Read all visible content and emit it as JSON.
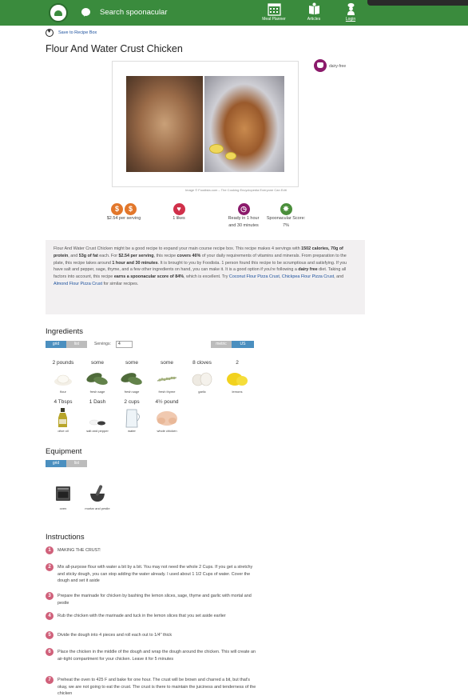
{
  "header": {
    "search_label": "Search spoonacular",
    "nav": [
      {
        "label": "Meal Planner",
        "icon": "calendar-icon"
      },
      {
        "label": "Articles",
        "icon": "book-icon"
      },
      {
        "label": "Login",
        "icon": "chef-icon"
      }
    ],
    "brand_color": "#3a8b3d"
  },
  "save_label": "Save to Recipe Box",
  "title": "Flour And Water Crust Chicken",
  "diet_badge": "dairy-free",
  "photo_credit": "Image © Foodista.com – The Cooking Encyclopedia Everyone Can Edit",
  "stats": [
    {
      "icon": "dollar-icon",
      "label": "$2.54 per serving"
    },
    {
      "icon": "heart-icon",
      "label": "1 likes"
    },
    {
      "icon": "clock-icon",
      "label": "Ready in 1 hour and 30 minutes"
    },
    {
      "icon": "score-icon",
      "label": "Spoonacular Score: 7%"
    }
  ],
  "summary": {
    "p1": "Flour And Water Crust Chicken might be a good recipe to expand your main course recipe box. This recipe makes 4 servings with ",
    "b1": "1502 calories, 70g of protein",
    "p2": ", and ",
    "b2": "53g of fat",
    "p3": " each. For ",
    "b3": "$2.54 per serving",
    "p4": ", this recipe ",
    "b4": "covers 46%",
    "p5": " of your daily requirements of vitamins and minerals. From preparation to the plate, this recipe takes around ",
    "b5": "1 hour and 30 minutes",
    "p6": ". It is brought to you by Foodista. 1 person found this recipe to be scrumptious and satisfying. If you have salt and pepper, sage, thyme, and a few other ingredients on hand, you can make it. It is a good option if you're following a ",
    "b6": "dairy free",
    "p7": " diet. Taking all factors into account, this recipe ",
    "b7": "earns a spoonacular score of 84%",
    "p8": ", which is excellent. Try ",
    "l1": "Coconut Flour Pizza Crust",
    "p9": ", ",
    "l2": "Chickpea Flour Pizza Crust",
    "p10": ", and ",
    "l3": "Almond Flour Pizza Crust",
    "p11": " for similar recipes."
  },
  "ingredients_heading": "Ingredients",
  "view_toggle": {
    "grid": "grid",
    "list": "list"
  },
  "servings_label": "Servings:",
  "servings_value": "4",
  "unit_toggle": {
    "metric": "metric",
    "us": "US"
  },
  "ingredients": [
    {
      "amount": "2 pounds",
      "name": "flour"
    },
    {
      "amount": "some",
      "name": "fresh sage"
    },
    {
      "amount": "some",
      "name": "fresh sage"
    },
    {
      "amount": "some",
      "name": "fresh thyme"
    },
    {
      "amount": "8 cloves",
      "name": "garlic"
    },
    {
      "amount": "2",
      "name": "lemons"
    },
    {
      "amount": "4 Tbsps",
      "name": "olive oil"
    },
    {
      "amount": "1 Dash",
      "name": "salt and pepper"
    },
    {
      "amount": "2 cups",
      "name": "water"
    },
    {
      "amount": "4½ pound",
      "name": "whole chicken"
    }
  ],
  "equipment_heading": "Equipment",
  "equipment": [
    {
      "name": "oven"
    },
    {
      "name": "mortar and pestle"
    }
  ],
  "instructions_heading": "Instructions",
  "steps": [
    {
      "n": "1",
      "text": "MAKING THE CRUST:"
    },
    {
      "n": "2",
      "text": "Mix all-purpose flour with water a bit by a bit. You may not need the whole 2 Cups. If you get a stretchy and sticky dough, you can stop adding the water already. I used about 1 1/2 Cups of water. Cover the dough and set it aside"
    },
    {
      "n": "3",
      "text": "Prepare the marinade for chicken by bashing the lemon slices, sage, thyme and garlic with mortal and pestle"
    },
    {
      "n": "4",
      "text": "Rub the chicken with the marinade and tuck in the lemon slices that you set aside earlier"
    },
    {
      "n": "5",
      "text": "Divide the dough into 4 pieces and roll each out to 1/4\" thick"
    },
    {
      "n": "6",
      "text": "Place the chicken in the middle of the dough and wrap the dough around the chicken. This will create an air-tight compartment for your chicken. Leave it for 5 minutes"
    },
    {
      "n": "7",
      "text": "Preheat the oven to 425 F and bake for one hour. The crust will be brown and charred a bit, but that's okay, we are not going to eat the crust. The crust is there to maintain the juiciness and tenderness of the chicken"
    }
  ]
}
